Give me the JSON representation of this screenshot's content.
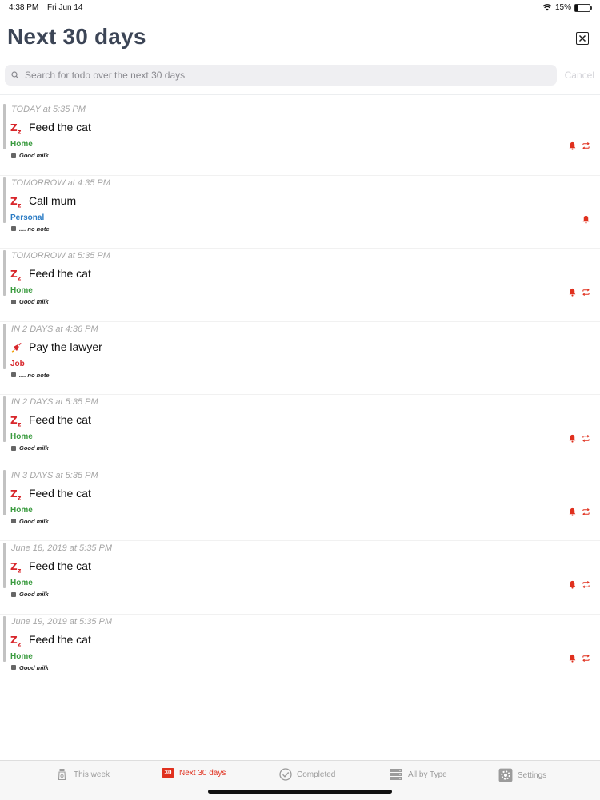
{
  "status_bar": {
    "time": "4:38 PM",
    "date": "Fri Jun 14",
    "battery": "15%",
    "battery_level": 0.15
  },
  "header": {
    "title": "Next 30 days"
  },
  "search": {
    "placeholder": "Search for todo over the next 30 days",
    "value": "",
    "cancel_label": "Cancel"
  },
  "colors": {
    "accent_red": "#e0301e",
    "home_green": "#3a9b3f",
    "personal_blue": "#2a7bc4",
    "job_red": "#d8262b"
  },
  "items": [
    {
      "when": "TODAY at 5:35 PM",
      "icon": "zz-icon",
      "title": "Feed the cat",
      "category": "Home",
      "category_color": "#3a9b3f",
      "note": "Good milk",
      "bell": true,
      "repeat": true
    },
    {
      "when": "TOMORROW at 4:35 PM",
      "icon": "zz-icon",
      "title": "Call mum",
      "category": "Personal",
      "category_color": "#2a7bc4",
      "note": ".... no note",
      "bell": true,
      "repeat": false
    },
    {
      "when": "TOMORROW at 5:35 PM",
      "icon": "zz-icon",
      "title": "Feed the cat",
      "category": "Home",
      "category_color": "#3a9b3f",
      "note": "Good milk",
      "bell": true,
      "repeat": true
    },
    {
      "when": "IN 2 DAYS at 4:36 PM",
      "icon": "rocket-icon",
      "title": "Pay the lawyer",
      "category": "Job",
      "category_color": "#d8262b",
      "note": ".... no note",
      "bell": false,
      "repeat": false
    },
    {
      "when": "IN 2 DAYS at 5:35 PM",
      "icon": "zz-icon",
      "title": "Feed the cat",
      "category": "Home",
      "category_color": "#3a9b3f",
      "note": "Good milk",
      "bell": true,
      "repeat": true
    },
    {
      "when": "IN 3 DAYS at 5:35 PM",
      "icon": "zz-icon",
      "title": "Feed the cat",
      "category": "Home",
      "category_color": "#3a9b3f",
      "note": "Good milk",
      "bell": true,
      "repeat": true
    },
    {
      "when": "June 18, 2019 at 5:35 PM",
      "icon": "zz-icon",
      "title": "Feed the cat",
      "category": "Home",
      "category_color": "#3a9b3f",
      "note": "Good milk",
      "bell": true,
      "repeat": true
    },
    {
      "when": "June 19, 2019 at 5:35 PM",
      "icon": "zz-icon",
      "title": "Feed the cat",
      "category": "Home",
      "category_color": "#3a9b3f",
      "note": "Good milk",
      "bell": true,
      "repeat": true
    }
  ],
  "tabs": [
    {
      "label": "This week",
      "icon": "bottle-icon",
      "active": false
    },
    {
      "label": "Next 30 days",
      "icon": "calendar-30-icon",
      "badge": "30",
      "active": true
    },
    {
      "label": "Completed",
      "icon": "checkmark-circle-icon",
      "active": false
    },
    {
      "label": "All by Type",
      "icon": "stack-icon",
      "active": false
    },
    {
      "label": "Settings",
      "icon": "gear-icon",
      "active": false
    }
  ]
}
